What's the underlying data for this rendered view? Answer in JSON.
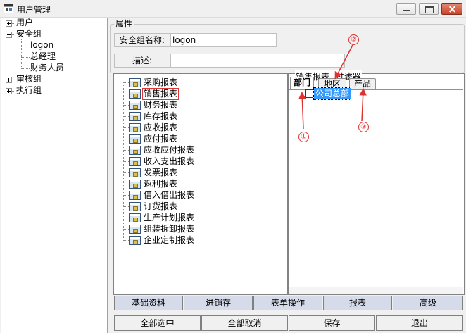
{
  "window": {
    "title": "用户管理",
    "icon": "app-user-manage-icon"
  },
  "tree": {
    "users": "用户",
    "security_group": "安全组",
    "security_children": [
      "logon",
      "总经理",
      "财务人员"
    ],
    "audit_group": "审核组",
    "exec_group": "执行组"
  },
  "props": {
    "group_title": "属性",
    "name_label": "安全组名称:",
    "name_value": "logon",
    "desc_label": "描述:",
    "desc_value": ""
  },
  "reports": {
    "items": [
      "采购报表",
      "销售报表",
      "财务报表",
      "库存报表",
      "应收报表",
      "应付报表",
      "应收应付报表",
      "收入支出报表",
      "发票报表",
      "返利报表",
      "借入借出报表",
      "订货报表",
      "生产计划报表",
      "组装拆卸报表",
      "企业定制报表"
    ],
    "selected_index": 1
  },
  "filter": {
    "title": "销售报表--过滤器",
    "tabs": [
      "部门",
      "地区",
      "产品"
    ],
    "active_tab": 0,
    "root_item": "公司总部",
    "root_checked": false
  },
  "annotations": [
    "①",
    "②",
    "③"
  ],
  "nav_buttons": [
    "基础资料",
    "进销存",
    "表单操作",
    "报表",
    "高级"
  ],
  "action_buttons": [
    "全部选中",
    "全部取消",
    "保存",
    "退出"
  ],
  "colors": {
    "selection": "#3399ff",
    "annotation": "#e03030",
    "nav_button": "#d6dbe9"
  }
}
